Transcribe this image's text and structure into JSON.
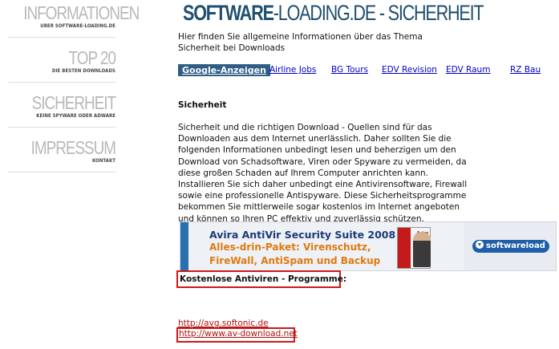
{
  "sidebar": {
    "items": [
      {
        "title": "INFORMATIONEN",
        "subtitle": "ÜBER SOFTWARE-LOADING.DE"
      },
      {
        "title": "TOP 20",
        "subtitle": "DIE BESTEN DOWNLOADS"
      },
      {
        "title": "SICHERHEIT",
        "subtitle": "KEINE SPYWARE ODER ADWARE"
      },
      {
        "title": "IMPRESSUM",
        "subtitle": "KONTAKT"
      }
    ]
  },
  "header": {
    "brand": "SOFTWARE",
    "title_rest": "-LOADING.DE - SICHERHEIT"
  },
  "intro": "Hier finden Sie allgemeine Informationen über das Thema Sicherheit bei Downloads",
  "ads": {
    "tag": "Google-Anzeigen",
    "links": [
      "Airline Jobs",
      "BG Tours",
      "EDV Revision",
      "EDV Raum",
      "RZ Bau"
    ]
  },
  "section": {
    "title": "Sicherheit",
    "body": "Sicherheit und die richtigen Download - Quellen sind für das Downloaden aus dem Internet unerlässlich. Daher sollten Sie die folgenden Informationen unbedingt lesen und beherzigen um den Download von Schadsoftware, Viren oder Spyware zu vermeiden, da diese großen Schaden auf Ihrem Computer anrichten kann. Installieren Sie sich daher unbedingt eine Antivirensoftware, Firewall sowie eine professionelle Antispyware. Diese Sicherheitsprogramme bekommen Sie mittlerweile sogar kostenlos im Internet angeboten und können so Ihren PC effektiv und zuverlässig schützen."
  },
  "banner": {
    "line1": "Avira AntiVir Security Suite 2008",
    "line2": "Alles-drin-Paket: Virenschutz,",
    "line3": "FireWall, AntiSpam und Backup",
    "box_label": "Avira",
    "logo": "softwareload"
  },
  "free": {
    "title": "Kostenlose Antiviren - Programme:",
    "links": [
      "http://avg.softonic.de",
      "http://www.av-download.net"
    ]
  },
  "colors": {
    "accent": "#1f4e6f",
    "ad_tag_bg": "#2e5d86",
    "highlight": "#d01818",
    "link": "#0000cc"
  }
}
